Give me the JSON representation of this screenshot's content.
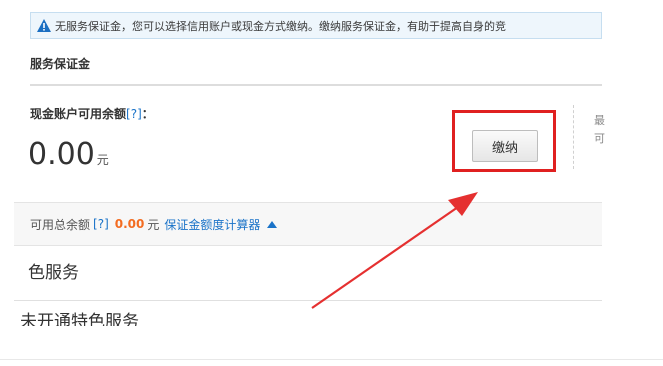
{
  "notice": {
    "text": "无服务保证金，您可以选择信用账户或现金方式缴纳。缴纳服务保证金，有助于提高自身的竞"
  },
  "deposit": {
    "section_title": "服务保证金",
    "cash_label": "现金账户可用余额",
    "help": "[?]",
    "colon": "：",
    "amount": "0.00",
    "unit": "元",
    "pay_button": "缴纳"
  },
  "side_chars": [
    "最",
    "可"
  ],
  "total": {
    "label": "可用总余额",
    "help": "[?]",
    "amount": "0.00",
    "unit": "元",
    "calculator_link": "保证金额度计算器"
  },
  "features": {
    "title": "色服务",
    "subtitle_partial": "未开通特色服务"
  },
  "colors": {
    "highlight": "#e02020",
    "link": "#1a73c8",
    "amount_accent": "#f36c21"
  }
}
